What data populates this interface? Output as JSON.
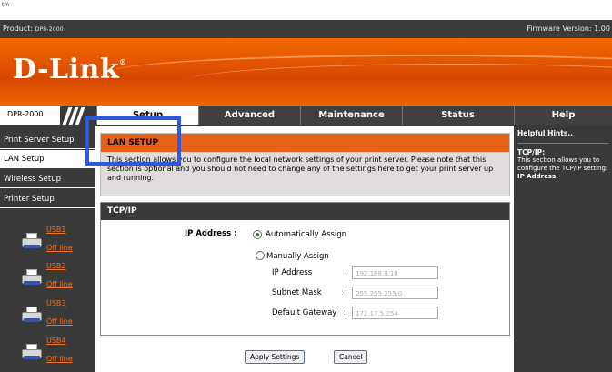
{
  "corner_mark": "tm",
  "topbar": {
    "product_label": "Product:",
    "product_model": "DPR-2000",
    "firmware": "Firmware Version: 1.00"
  },
  "brand": {
    "logo": "D-Link"
  },
  "nav": {
    "model": "DPR-2000",
    "tabs": [
      {
        "label": "Setup",
        "active": true
      },
      {
        "label": "Advanced"
      },
      {
        "label": "Maintenance"
      },
      {
        "label": "Status"
      }
    ],
    "help": "Help"
  },
  "sidebar": {
    "items": [
      {
        "label": "Print Server Setup"
      },
      {
        "label": "LAN Setup",
        "active": true
      },
      {
        "label": "Wireless Setup"
      },
      {
        "label": "Printer Setup"
      }
    ],
    "usb": [
      {
        "name": "USB1",
        "status": "Off line"
      },
      {
        "name": "USB2",
        "status": "Off line"
      },
      {
        "name": "USB3",
        "status": "Off line"
      },
      {
        "name": "USB4",
        "status": "Off line"
      }
    ]
  },
  "lan": {
    "title": "LAN SETUP",
    "description": "This section allows you to configure the local network settings of your print server. Please note that this section is optional and you should not need to change any of the settings here to get your print server up and running."
  },
  "tcpip": {
    "title": "TCP/IP",
    "ip_address_label": "IP Address :",
    "auto_assign": "Automatically Assign",
    "manual_assign": "Manually Assign",
    "fields": {
      "ip": {
        "label": "IP Address",
        "colon": ":",
        "value": "192.168.0.10"
      },
      "mask": {
        "label": "Subnet Mask",
        "colon": ":",
        "value": "255.255.255.0"
      },
      "gateway": {
        "label": "Default Gateway",
        "colon": ":",
        "value": "172.17.5.254"
      }
    }
  },
  "buttons": {
    "apply": "Apply Settings",
    "cancel": "Cancel"
  },
  "help": {
    "heading": "Helpful Hints..",
    "topic": "TCP/IP:",
    "text_prefix": "This section allows you to configure the TCP/IP setting:",
    "text_bold": "IP Address."
  },
  "colors": {
    "accent": "#e8621a",
    "dark": "#3a3a3a",
    "highlight": "#2f58e0"
  }
}
